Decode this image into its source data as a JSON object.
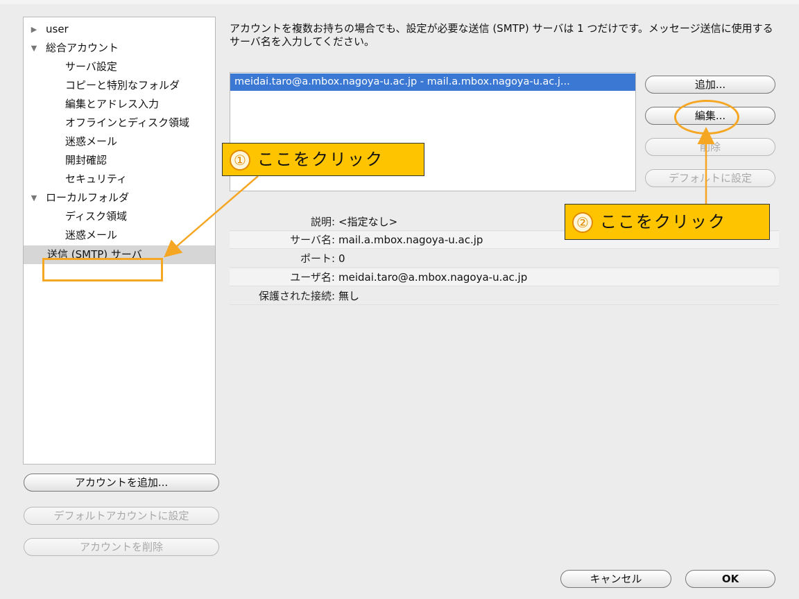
{
  "sidebar": {
    "items": [
      {
        "label": "user",
        "arrow": "▶"
      },
      {
        "label": "総合アカウント",
        "arrow": "▼"
      },
      {
        "label": "サーバ設定"
      },
      {
        "label": "コピーと特別なフォルダ"
      },
      {
        "label": "編集とアドレス入力"
      },
      {
        "label": "オフラインとディスク領域"
      },
      {
        "label": "迷惑メール"
      },
      {
        "label": "開封確認"
      },
      {
        "label": "セキュリティ"
      },
      {
        "label": "ローカルフォルダ",
        "arrow": "▼"
      },
      {
        "label": "ディスク領域"
      },
      {
        "label": "迷惑メール"
      },
      {
        "label": "送信 (SMTP) サーバ",
        "selected": true
      }
    ],
    "buttons": {
      "add_account": "アカウントを追加...",
      "set_default_account": "デフォルトアカウントに設定",
      "delete_account": "アカウントを削除"
    }
  },
  "main": {
    "description": "アカウントを複数お持ちの場合でも、設定が必要な送信 (SMTP) サーバは 1 つだけです。メッセージ送信に使用するサーバ名を入力してください。",
    "server_list": [
      "meidai.taro@a.mbox.nagoya-u.ac.jp - mail.a.mbox.nagoya-u.ac.j..."
    ],
    "buttons": {
      "add": "追加...",
      "edit": "編集...",
      "delete": "削除",
      "set_default": "デフォルトに設定"
    },
    "details": [
      {
        "key": "説明:",
        "value": "<指定なし>"
      },
      {
        "key": "サーバ名:",
        "value": "mail.a.mbox.nagoya-u.ac.jp"
      },
      {
        "key": "ポート:",
        "value": "0"
      },
      {
        "key": "ユーザ名:",
        "value": "meidai.taro@a.mbox.nagoya-u.ac.jp"
      },
      {
        "key": "保護された接続:",
        "value": "無し"
      }
    ]
  },
  "footer": {
    "cancel": "キャンセル",
    "ok": "OK"
  },
  "annotations": {
    "callout1": {
      "number": "①",
      "text": "ここをクリック"
    },
    "callout2": {
      "number": "②",
      "text": "ここをクリック"
    }
  },
  "colors": {
    "selection": "#3a78d4",
    "callout_fill": "#ffc400",
    "highlight": "#f5a623"
  }
}
